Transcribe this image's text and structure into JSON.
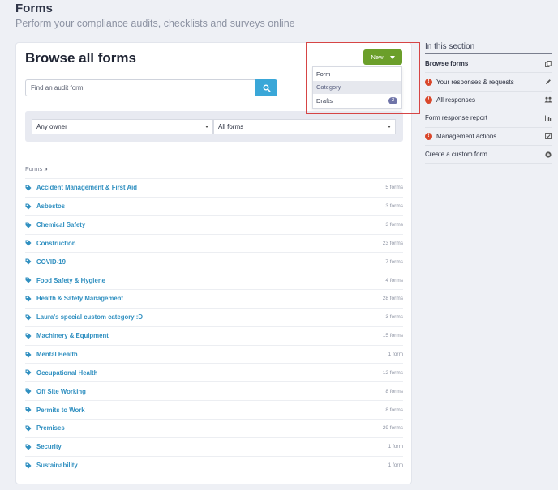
{
  "page": {
    "title": "Forms",
    "subtitle": "Perform your compliance audits, checklists and surveys online"
  },
  "card": {
    "title": "Browse all forms",
    "new_button": "New",
    "dropdown": [
      {
        "label": "Form",
        "active": false,
        "badge": ""
      },
      {
        "label": "Category",
        "active": true,
        "badge": ""
      },
      {
        "label": "Drafts",
        "active": false,
        "badge": "2"
      }
    ],
    "search": {
      "placeholder": "Find an audit form",
      "value": ""
    },
    "filters": {
      "owner": "Any owner",
      "forms": "All forms"
    },
    "breadcrumb": "Forms",
    "breadcrumb_sep": "»",
    "categories": [
      {
        "label": "Accident Management & First Aid",
        "count": "5 forms"
      },
      {
        "label": "Asbestos",
        "count": "3 forms"
      },
      {
        "label": "Chemical Safety",
        "count": "3 forms"
      },
      {
        "label": "Construction",
        "count": "23 forms"
      },
      {
        "label": "COVID-19",
        "count": "7 forms"
      },
      {
        "label": "Food Safety & Hygiene",
        "count": "4 forms"
      },
      {
        "label": "Health & Safety Management",
        "count": "28 forms"
      },
      {
        "label": "Laura's special custom category :D",
        "count": "3 forms"
      },
      {
        "label": "Machinery & Equipment",
        "count": "15 forms"
      },
      {
        "label": "Mental Health",
        "count": "1 form"
      },
      {
        "label": "Occupational Health",
        "count": "12 forms"
      },
      {
        "label": "Off Site Working",
        "count": "8 forms"
      },
      {
        "label": "Permits to Work",
        "count": "8 forms"
      },
      {
        "label": "Premises",
        "count": "29 forms"
      },
      {
        "label": "Security",
        "count": "1 form"
      },
      {
        "label": "Sustainability",
        "count": "1 form"
      }
    ]
  },
  "sidebar": {
    "title": "In this section",
    "items": [
      {
        "label": "Browse forms",
        "alert": false,
        "bold": true,
        "icon": "copy-icon"
      },
      {
        "label": "Your responses & requests",
        "alert": true,
        "bold": false,
        "icon": "pencil-icon"
      },
      {
        "label": "All responses",
        "alert": true,
        "bold": false,
        "icon": "users-icon"
      },
      {
        "label": "Form response report",
        "alert": false,
        "bold": false,
        "icon": "bar-chart-icon"
      },
      {
        "label": "Management actions",
        "alert": true,
        "bold": false,
        "icon": "checkbox-icon"
      },
      {
        "label": "Create a custom form",
        "alert": false,
        "bold": false,
        "icon": "plus-circle-icon"
      }
    ],
    "alert_mark": "!"
  },
  "colors": {
    "accent_green": "#6b9f2a",
    "search_blue": "#3aa7d8",
    "link_blue": "#2f8fc0",
    "alert_red": "#d9472b",
    "highlight_red": "#d64545"
  }
}
